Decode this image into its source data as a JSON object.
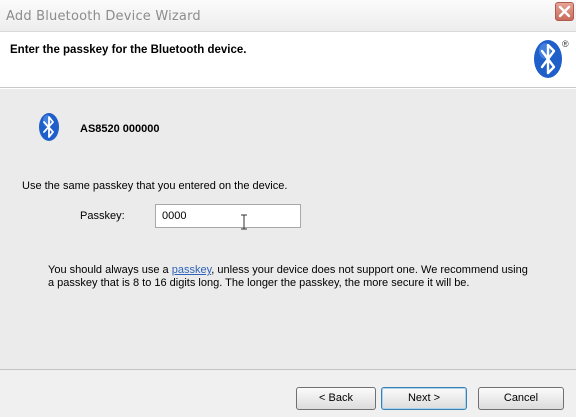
{
  "window": {
    "title": "Add Bluetooth Device Wizard",
    "close_icon": "close-icon"
  },
  "header": {
    "title": "Enter the passkey for the Bluetooth device.",
    "icon": "bluetooth-icon",
    "icon_registered_mark": "®"
  },
  "device": {
    "icon": "bluetooth-icon",
    "name": "AS8520  000000"
  },
  "instruction": "Use the same passkey that you entered on the device.",
  "passkey": {
    "label": "Passkey:",
    "value": "0000"
  },
  "note": {
    "before_link": "You should always use a ",
    "link_text": "passkey",
    "after_link": ", unless your device does not support one. We recommend using a passkey that is 8 to 16 digits long. The longer the passkey, the more secure it will be."
  },
  "buttons": {
    "back": "< Back",
    "next": "Next >",
    "cancel": "Cancel"
  },
  "colors": {
    "bluetooth_blue": "#1f5fc9",
    "link": "#2e63b8",
    "body_bg": "#ebebeb"
  }
}
